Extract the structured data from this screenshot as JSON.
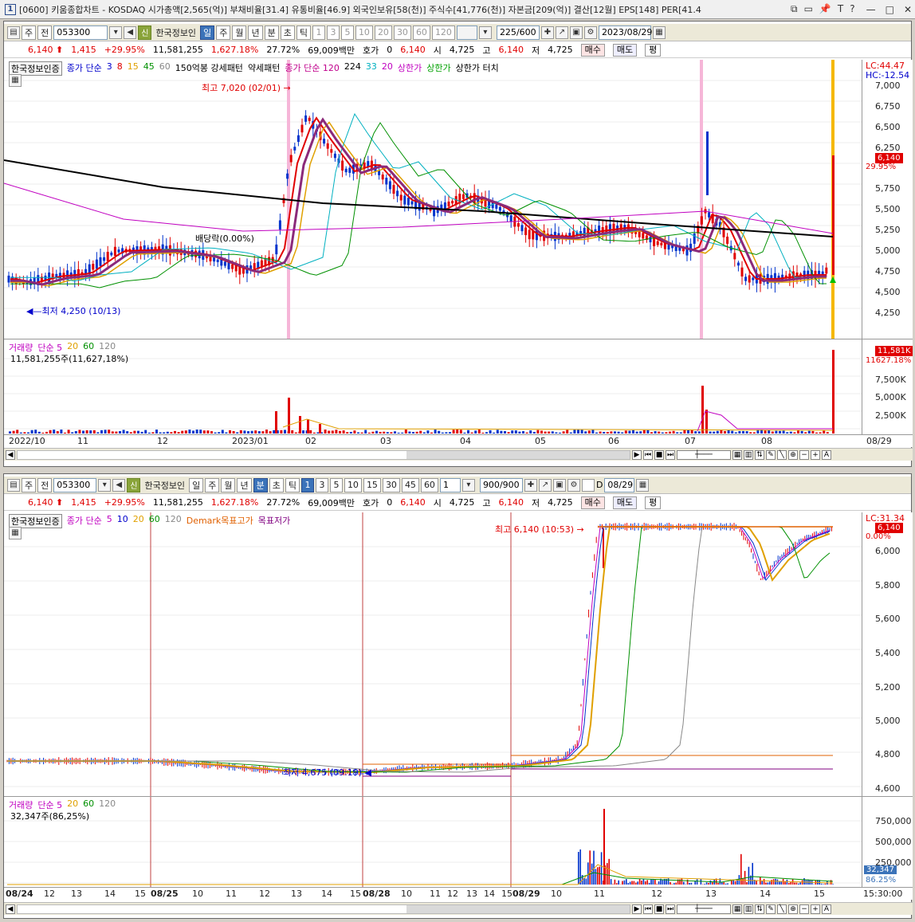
{
  "title": {
    "window_num": "1",
    "text": "[0600] 키움종합차트 - KOSDAQ 시가총액[2,565(억)] 부채비율[31.4] 유통비율[46.9] 외국인보유[58(천)] 주식수[41,776(천)] 자본금[209(억)] 결산[12월] EPS[148] PER[41.4"
  },
  "top": {
    "toolbar": {
      "period_btn": "주",
      "prev_btn": "전",
      "code": "053300",
      "stock_tag": "신",
      "stock_name": "한국정보인",
      "tf": [
        "일",
        "주",
        "월",
        "년"
      ],
      "tf2": [
        "분",
        "초",
        "틱"
      ],
      "nums": [
        "1",
        "3",
        "5",
        "10",
        "20",
        "30",
        "60",
        "120"
      ],
      "count": "225",
      "count_max": "/600",
      "date": "2023/08/29"
    },
    "quote": {
      "price": "6,140",
      "change": "1,415",
      "rate": "+29.95%",
      "volume": "11,581,255",
      "vol_rate": "1,627.18%",
      "turnover": "27.72%",
      "amount": "69,009백만",
      "hoga_label": "호가",
      "hoga_val": "0",
      "ask": "6,140",
      "open_label": "시",
      "open": "4,725",
      "high_label": "고",
      "high": "6,140",
      "low_label": "저",
      "low": "4,725",
      "buy": "매수",
      "sell": "매도",
      "eval": "평"
    },
    "legend": {
      "name": "한국정보인증",
      "ma": "종가 단순",
      "ma_periods": [
        "3",
        "8",
        "15",
        "45",
        "60"
      ],
      "p150": "150억봉 강세패턴",
      "weak": "약세패턴",
      "ma2": "종가 단순 120",
      "ma2b": [
        "224",
        "33",
        "20"
      ],
      "upper": "상한가",
      "upper2": "상한가",
      "touch": "상한가 터치"
    },
    "y_labels": [
      "7,000",
      "6,750",
      "6,500",
      "6,250",
      "5,750",
      "5,500",
      "5,250",
      "5,000",
      "4,750",
      "4,500",
      "4,250"
    ],
    "lc": "LC:44.47",
    "hc": "HC:-12.54",
    "price_tag": "6,140",
    "pct_tag": "29.95%",
    "high_ann": "최고 7,020 (02/01)",
    "low_ann": "최저 4,250 (10/13)",
    "div_ann": "배당락(0.00%)",
    "vol_legend": [
      "거래량",
      "단순 5",
      "20",
      "60",
      "120"
    ],
    "vol_value": "11,581,255주(11,627,18%)",
    "vol_y": [
      "7,500K",
      "5,000K",
      "2,500K"
    ],
    "vol_tag": "11,581K",
    "vol_tag2": "11627.18%",
    "x_labels": [
      "2022/10",
      "11",
      "12",
      "2023/01",
      "02",
      "03",
      "04",
      "05",
      "06",
      "07",
      "08",
      "08/29"
    ],
    "chart_data": {
      "type": "candlestick",
      "ylim": [
        4100,
        7100
      ],
      "high": 7020,
      "high_date": "02/01",
      "low": 4250,
      "low_date": "10/13",
      "last": 6140
    }
  },
  "bottom": {
    "toolbar": {
      "period_btn": "주",
      "prev_btn": "전",
      "code": "053300",
      "stock_tag": "신",
      "stock_name": "한국정보인",
      "tf": [
        "일",
        "주",
        "월",
        "년"
      ],
      "tf2": [
        "분",
        "초",
        "틱"
      ],
      "nums": [
        "1",
        "3",
        "5",
        "10",
        "15",
        "30",
        "45",
        "60"
      ],
      "unit": "1",
      "count": "900",
      "count_max": "/900",
      "checkbox": "D",
      "date": "08/29"
    },
    "quote": {
      "price": "6,140",
      "change": "1,415",
      "rate": "+29.95%",
      "volume": "11,581,255",
      "vol_rate": "1,627.18%",
      "turnover": "27.72%",
      "amount": "69,009백만",
      "hoga_label": "호가",
      "hoga_val": "0",
      "ask": "6,140",
      "open_label": "시",
      "open": "4,725",
      "high_label": "고",
      "high": "6,140",
      "low_label": "저",
      "low": "4,725",
      "buy": "매수",
      "sell": "매도",
      "eval": "평"
    },
    "legend": {
      "name": "한국정보인증",
      "ma": "종가 단순",
      "ma_periods": [
        "5",
        "10",
        "20",
        "60",
        "120"
      ],
      "demark_hi": "Demark목표고가",
      "demark_lo": "목표저가"
    },
    "y_labels": [
      "6,000",
      "5,800",
      "5,600",
      "5,400",
      "5,200",
      "5,000",
      "4,800",
      "4,600"
    ],
    "lc": "LC:31.34",
    "price_tag": "6,140",
    "pct_tag": "0.00%",
    "high_ann": "최고 6,140 (10:53)",
    "low_ann": "최저 4,675 (09:19)",
    "vol_legend": [
      "거래량",
      "단순 5",
      "20",
      "60",
      "120"
    ],
    "vol_value": "32,347주(86,25%)",
    "vol_y": [
      "750,000",
      "500,000",
      "250,000"
    ],
    "vol_tag": "32,347",
    "vol_tag2": "86.25%",
    "x_labels": [
      "08/24",
      "12",
      "13",
      "14",
      "15",
      "08/25",
      "10",
      "11",
      "12",
      "13",
      "14",
      "15",
      "08/28",
      "10",
      "11",
      "12",
      "13",
      "14",
      "15",
      "08/29",
      "10",
      "11",
      "12",
      "13",
      "14",
      "15",
      "15:30:00"
    ],
    "chart_data": {
      "type": "candlestick",
      "ylim": [
        4550,
        6200
      ],
      "high": 6140,
      "high_time": "10:53",
      "low": 4675,
      "low_time": "09:19"
    }
  }
}
